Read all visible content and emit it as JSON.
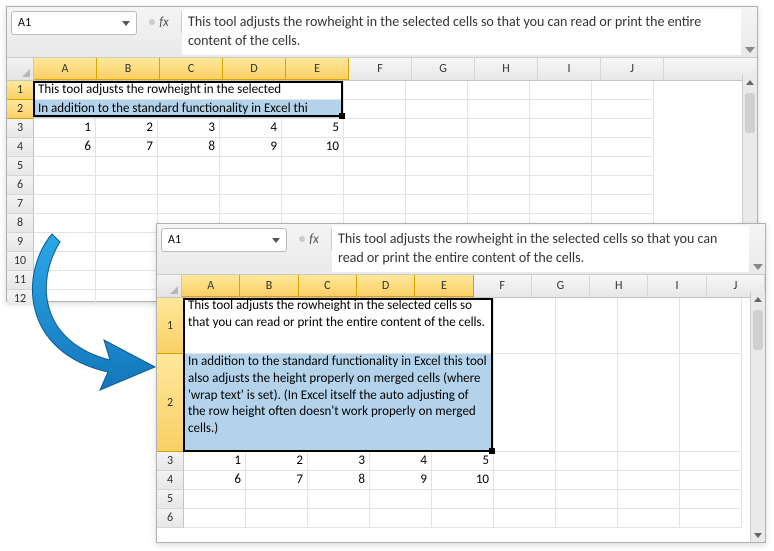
{
  "name_box": {
    "ref": "A1"
  },
  "fx_label": "fx",
  "formula_bar_text": "This tool adjusts the rowheight in the selected cells so that you can read or print the entire content of the cells.",
  "columns": [
    "A",
    "B",
    "C",
    "D",
    "E",
    "F",
    "G",
    "H",
    "I",
    "J"
  ],
  "selected_cols_count": 5,
  "top_panel": {
    "rows_visible": 12,
    "row1_text": "This tool adjusts the rowheight in the selected",
    "row2_text": "In addition to the standard functionality in Excel thi",
    "row3": [
      "1",
      "2",
      "3",
      "4",
      "5"
    ],
    "row4": [
      "6",
      "7",
      "8",
      "9",
      "10"
    ]
  },
  "bottom_panel": {
    "row1_text": "This tool adjusts the rowheight in the selected cells so that you can read or print the entire content of the cells.",
    "row2_text": "In addition to the standard functionality in Excel this tool also adjusts the height properly on merged cells (where 'wrap text' is set). (In Excel itself the auto adjusting of the row height often doesn't work properly on merged cells.)",
    "row3": [
      "1",
      "2",
      "3",
      "4",
      "5"
    ],
    "row4": [
      "6",
      "7",
      "8",
      "9",
      "10"
    ]
  },
  "colors": {
    "col_sel": "#f9cf66",
    "blue_hl": "#b3d3eb"
  }
}
